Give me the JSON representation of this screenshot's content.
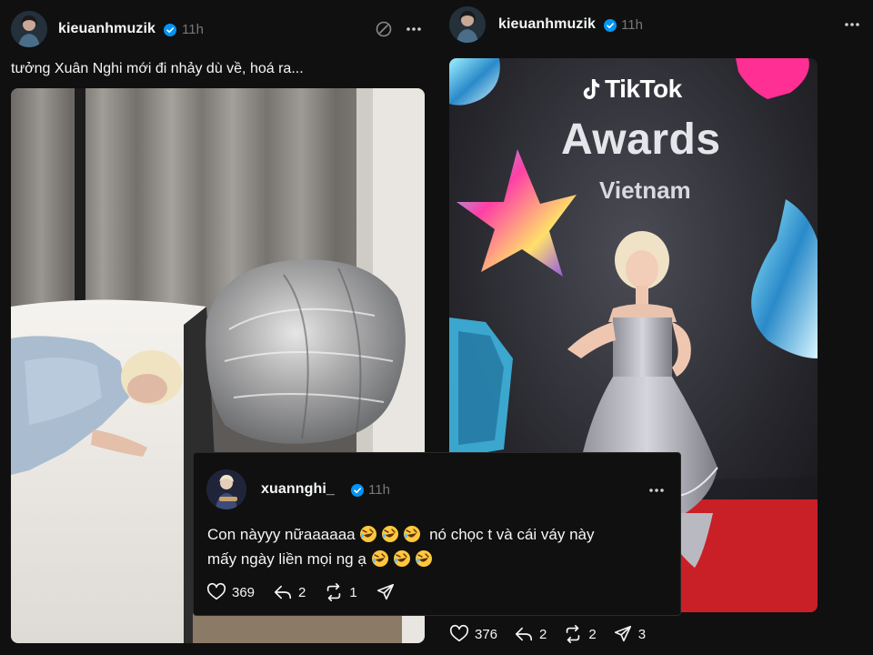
{
  "left_post": {
    "username": "kieuanhmuzik",
    "time": "11h",
    "caption": "tưởng Xuân Nghi mới đi nhảy dù về, hoá ra...",
    "media": "photo of a person lying face-down on a bed next to a large grey puffy satin skirt"
  },
  "right_post": {
    "username": "kieuanhmuzik",
    "time": "11h",
    "media_banner": {
      "brand": "TikTok",
      "event": "Awards",
      "country": "Vietnam"
    },
    "actions": {
      "likes": "376",
      "replies": "2",
      "reposts": "2",
      "shares": "3"
    }
  },
  "reply_card": {
    "username": "xuannghi_",
    "time": "11h",
    "text_line1": "Con nàyyy nữaaaaaa",
    "text_line1_after": "nó chọc t và cái váy này",
    "text_line2": "mấy ngày liền mọi ng ạ",
    "actions": {
      "likes": "369",
      "replies": "2",
      "reposts": "1"
    }
  },
  "colors": {
    "background": "#101010",
    "text": "#f3f5f7",
    "muted": "#777777",
    "verified": "#0095f6",
    "carpet": "#d0222a"
  },
  "icons": [
    "verified-icon",
    "mute-icon",
    "more-icon",
    "heart-icon",
    "reply-icon",
    "repost-icon",
    "share-icon",
    "rofl-emoji-icon"
  ]
}
